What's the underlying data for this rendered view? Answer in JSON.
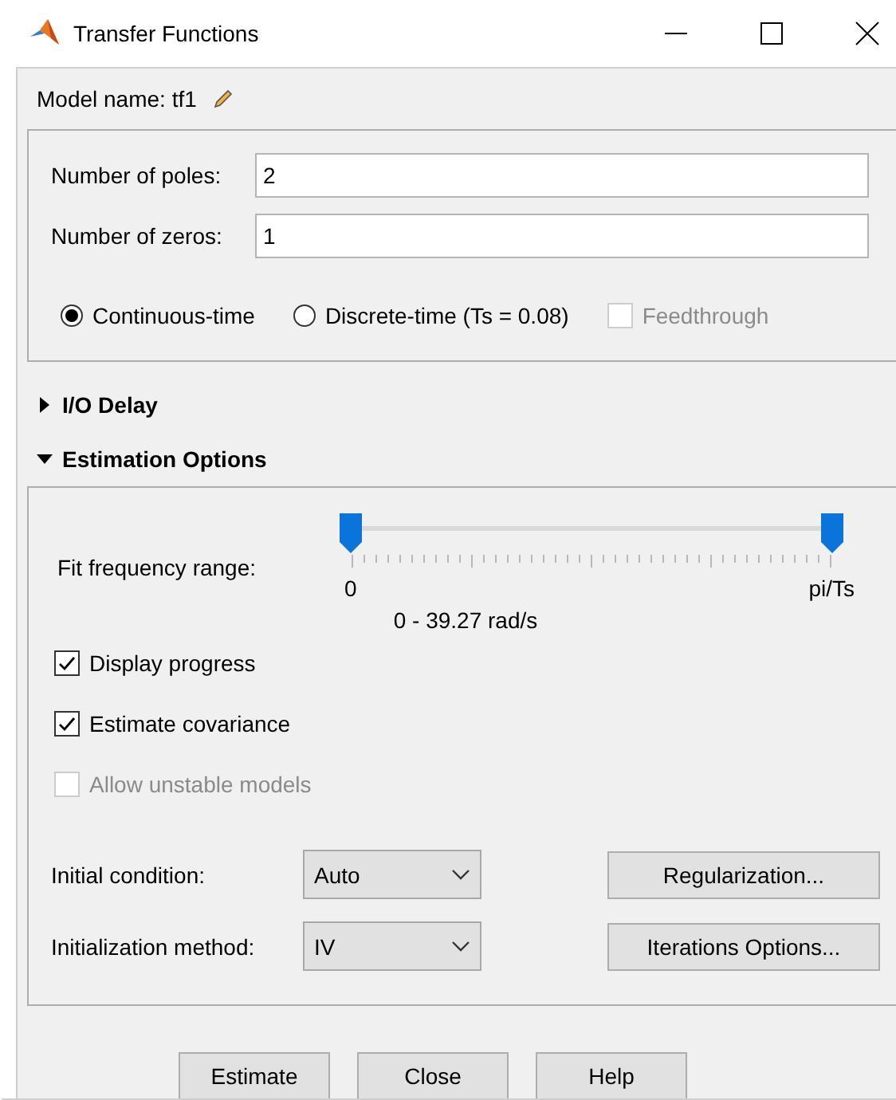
{
  "window": {
    "title": "Transfer Functions"
  },
  "model_name": "Model name: tf1",
  "structure": {
    "fields": [
      {
        "label": "Number of poles:",
        "value": "2"
      },
      {
        "label": "Number of zeros:",
        "value": "1"
      }
    ],
    "time_domain": [
      {
        "label": "Continuous-time",
        "selected": true
      },
      {
        "label": "Discrete-time (Ts = 0.08)",
        "selected": false
      }
    ],
    "feedthrough": {
      "label": "Feedthrough",
      "checked": false,
      "disabled": true
    }
  },
  "io_delay": {
    "title": "I/O Delay",
    "expanded": false
  },
  "estimation_options": {
    "title": "Estimation Options",
    "expanded": true,
    "fit_range": {
      "label": "Fit frequency range:",
      "low_thumb": {
        "level": 0
      },
      "high_thumb": {
        "level": 1
      },
      "min_label": "0",
      "max_label": "pi/Ts",
      "reading": "0 - 39.27 rad/s"
    },
    "checkboxes": [
      {
        "label": "Display progress",
        "checked": true,
        "disabled": false
      },
      {
        "label": "Estimate covariance",
        "checked": true,
        "disabled": false
      },
      {
        "label": "Allow unstable models",
        "checked": false,
        "disabled": true
      }
    ],
    "settings": [
      {
        "label": "Initial condition:",
        "value": "Auto",
        "button": "Regularization..."
      },
      {
        "label": "Initialization method:",
        "value": "IV",
        "button": "Iterations Options..."
      }
    ]
  },
  "buttons": [
    "Estimate",
    "Close",
    "Help"
  ]
}
